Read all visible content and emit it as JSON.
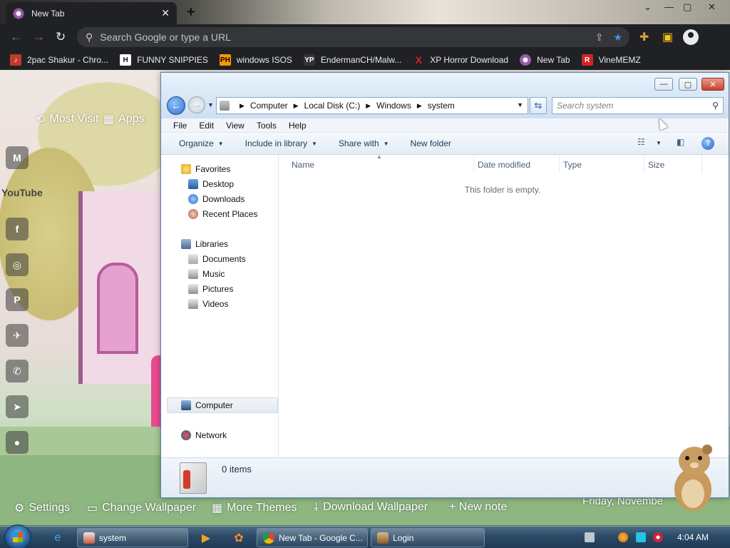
{
  "chrome": {
    "tab_title": "New Tab",
    "tab_close": "✕",
    "new_tab": "+",
    "window_controls": [
      "⌄",
      "—",
      "▢",
      "✕"
    ],
    "omnibox_placeholder": "Search Google or type a URL",
    "bookmarks": [
      {
        "label": "2pac Shakur - Chro...",
        "icon": "music-icon",
        "color": "#c0392b"
      },
      {
        "label": "FUNNY SNIPPIES",
        "icon": "H",
        "color": "#111111"
      },
      {
        "label": "windows ISOS",
        "icon": "PH",
        "color": "#ff9900"
      },
      {
        "label": "EndermanCH/Malw...",
        "icon": "YP",
        "color": "#333333"
      },
      {
        "label": "XP Horror Download",
        "icon": "X",
        "color": "#e02020"
      },
      {
        "label": "New Tab",
        "icon": "newtab-icon",
        "color": "#9b5aa8"
      },
      {
        "label": "VineMEMZ",
        "icon": "R",
        "color": "#d0232b"
      }
    ]
  },
  "ntp": {
    "most_visited": "Most Visit",
    "apps": "Apps",
    "youtube": "YouTube",
    "bottom_links": [
      "Settings",
      "Change Wallpaper",
      "More Themes",
      "Download Wallpaper",
      "+ New note"
    ],
    "date": "Friday, Novembe"
  },
  "explorer": {
    "breadcrumbs": [
      "Computer",
      "Local Disk (C:)",
      "Windows",
      "system"
    ],
    "search_placeholder": "Search system",
    "menus": [
      "File",
      "Edit",
      "View",
      "Tools",
      "Help"
    ],
    "commands": [
      "Organize",
      "Include in library",
      "Share with",
      "New folder"
    ],
    "columns": [
      "Name",
      "Date modified",
      "Type",
      "Size"
    ],
    "empty_message": "This folder is empty.",
    "nav": {
      "favorites": "Favorites",
      "favorites_items": [
        "Desktop",
        "Downloads",
        "Recent Places"
      ],
      "libraries": "Libraries",
      "libraries_items": [
        "Documents",
        "Music",
        "Pictures",
        "Videos"
      ],
      "computer": "Computer",
      "network": "Network"
    },
    "item_count": "0 items"
  },
  "taskbar": {
    "tasks": [
      "system",
      "New Tab - Google C...",
      "Login"
    ],
    "clock": "4:04 AM"
  }
}
